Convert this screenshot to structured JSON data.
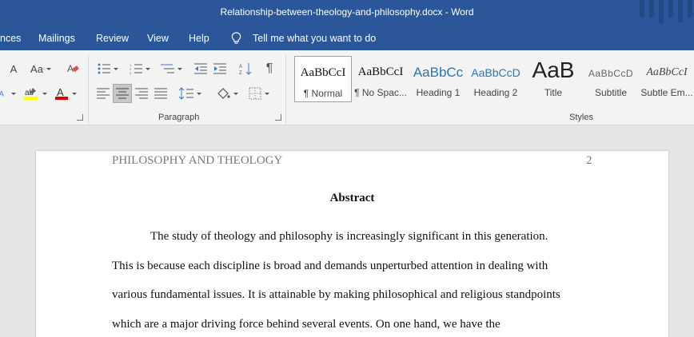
{
  "window": {
    "title": "Relationship-between-theology-and-philosophy.docx  -  Word"
  },
  "menu": {
    "tabs": [
      "nces",
      "Mailings",
      "Review",
      "View",
      "Help"
    ],
    "tell_me": "Tell me what you want to do"
  },
  "ribbon": {
    "font_case_label": "Aa",
    "font_grow_label": "A",
    "paragraph_group_label": "Paragraph",
    "styles_group_label": "Styles",
    "colors": {
      "highlight": "#ffff00",
      "font_color": "#e00000"
    }
  },
  "styles": [
    {
      "sample": "AaBbCcI",
      "name": "¶ Normal"
    },
    {
      "sample": "AaBbCcI",
      "name": "¶ No Spac..."
    },
    {
      "sample": "AaBbCc",
      "name": "Heading 1"
    },
    {
      "sample": "AaBbCcD",
      "name": "Heading 2"
    },
    {
      "sample": "AaB",
      "name": "Title"
    },
    {
      "sample": "AaBbCcD",
      "name": "Subtitle"
    },
    {
      "sample": "AaBbCcI",
      "name": "Subtle Em..."
    }
  ],
  "document": {
    "header_left": "PHILOSOPHY AND THEOLOGY",
    "page_number": "2",
    "heading": "Abstract",
    "lines": [
      "The study of theology and philosophy is increasingly significant in this generation.",
      "This is because each discipline is broad and demands unperturbed attention in dealing with",
      "various fundamental issues. It is attainable by making philosophical and religious standpoints",
      "which are a major driving force behind several events. On one hand, we have the"
    ]
  }
}
